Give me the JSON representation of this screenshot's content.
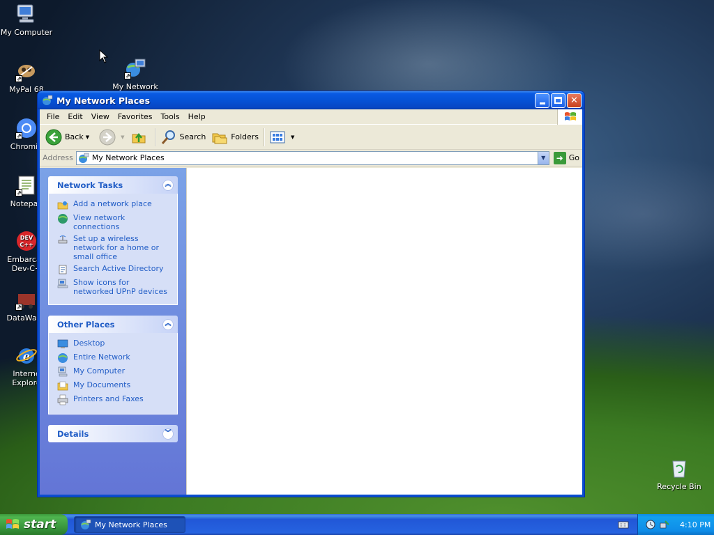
{
  "desktop": {
    "icons": [
      {
        "label": "My Computer",
        "icon": "my-computer-icon"
      },
      {
        "label": "MyPal 68",
        "icon": "mypal-icon"
      },
      {
        "label": "My Network",
        "icon": "my-network-places-icon"
      },
      {
        "label": "Chromiu",
        "icon": "chromium-icon"
      },
      {
        "label": "Notepad",
        "icon": "notepad-icon"
      },
      {
        "label": "Embarcad Dev-C+",
        "icon": "devcpp-icon"
      },
      {
        "label": "DataWago",
        "icon": "datawagon-icon"
      },
      {
        "label": "Interne Explore",
        "icon": "internet-explorer-icon"
      },
      {
        "label": "Recycle Bin",
        "icon": "recycle-bin-icon"
      }
    ]
  },
  "window": {
    "title": "My Network Places",
    "menu": [
      "File",
      "Edit",
      "View",
      "Favorites",
      "Tools",
      "Help"
    ],
    "toolbar": {
      "back_label": "Back",
      "search_label": "Search",
      "folders_label": "Folders"
    },
    "address": {
      "label": "Address",
      "value": "My Network Places",
      "go_label": "Go"
    },
    "taskpane": {
      "network_tasks": {
        "title": "Network Tasks",
        "items": [
          "Add a network place",
          "View network connections",
          "Set up a wireless network for a home or small office",
          "Search Active Directory",
          "Show icons for networked UPnP devices"
        ]
      },
      "other_places": {
        "title": "Other Places",
        "items": [
          "Desktop",
          "Entire Network",
          "My Computer",
          "My Documents",
          "Printers and Faxes"
        ]
      },
      "details": {
        "title": "Details"
      }
    }
  },
  "taskbar": {
    "start_label": "start",
    "task_label": "My Network Places",
    "clock": "4:10 PM"
  },
  "colors": {
    "title_blue": "#0552d6",
    "taskpane_link": "#215dc6",
    "start_green": "#36923a"
  }
}
